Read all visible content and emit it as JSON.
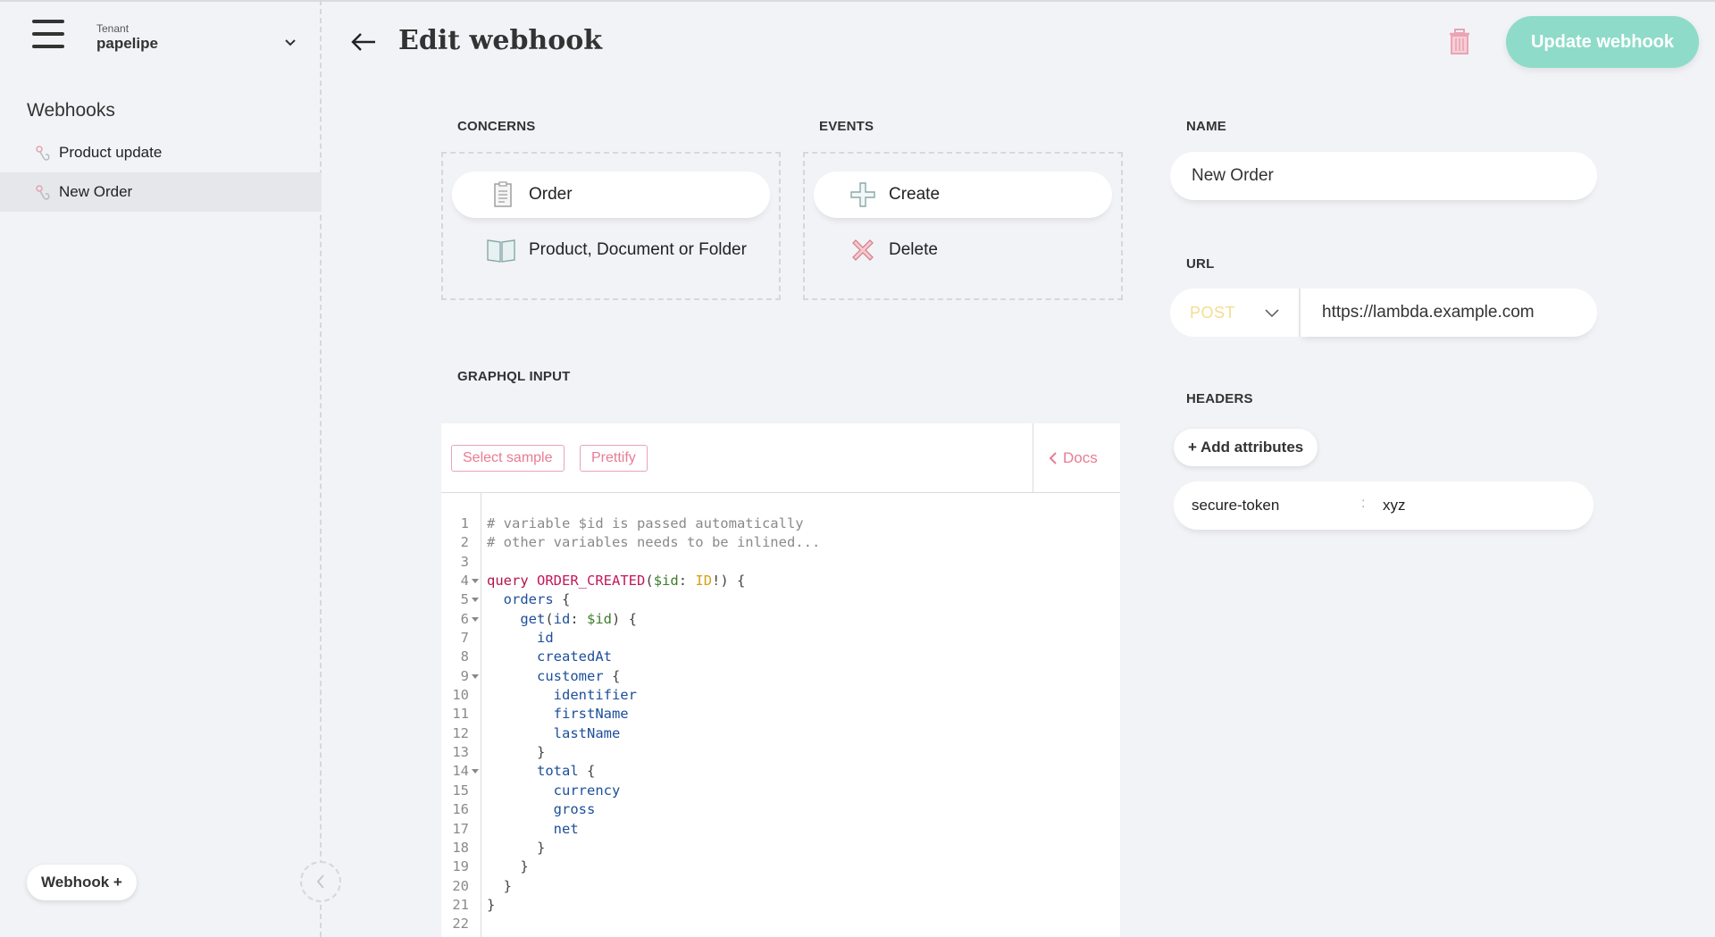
{
  "sidebar": {
    "tenant_label": "Tenant",
    "tenant_name": "papelipe",
    "section_title": "Webhooks",
    "items": [
      {
        "label": "Product update",
        "active": false
      },
      {
        "label": "New Order",
        "active": true
      }
    ],
    "add_button": "Webhook +"
  },
  "header": {
    "title": "Edit webhook",
    "update_button": "Update webhook"
  },
  "concerns": {
    "label": "CONCERNS",
    "options": [
      {
        "label": "Order",
        "icon": "clipboard-icon",
        "selected": true
      },
      {
        "label": "Product, Document or Folder",
        "icon": "book-icon",
        "selected": false
      }
    ]
  },
  "events": {
    "label": "EVENTS",
    "options": [
      {
        "label": "Create",
        "icon": "plus-icon",
        "selected": true
      },
      {
        "label": "Delete",
        "icon": "x-icon",
        "selected": false
      }
    ]
  },
  "name": {
    "label": "NAME",
    "value": "New Order"
  },
  "url": {
    "label": "URL",
    "method": "POST",
    "value": "https://lambda.example.com"
  },
  "headers": {
    "label": "HEADERS",
    "add_button": "+ Add attributes",
    "items": [
      {
        "key": "secure-token",
        "separator": ":",
        "value": "xyz"
      }
    ]
  },
  "graphql": {
    "label": "GRAPHQL INPUT",
    "select_sample": "Select sample",
    "prettify": "Prettify",
    "docs": "Docs",
    "lines": [
      {
        "n": "1",
        "fold": false,
        "tokens": [
          [
            "c-comment",
            "# variable $id is passed automatically"
          ]
        ]
      },
      {
        "n": "2",
        "fold": false,
        "tokens": [
          [
            "c-comment",
            "# other variables needs to be inlined..."
          ]
        ]
      },
      {
        "n": "3",
        "fold": false,
        "tokens": []
      },
      {
        "n": "4",
        "fold": true,
        "tokens": [
          [
            "c-kw",
            "query"
          ],
          [
            "c-punct",
            " "
          ],
          [
            "c-def",
            "ORDER_CREATED"
          ],
          [
            "c-punct",
            "("
          ],
          [
            "c-var",
            "$id"
          ],
          [
            "c-punct",
            ": "
          ],
          [
            "c-type",
            "ID"
          ],
          [
            "c-punct",
            "!) {"
          ]
        ]
      },
      {
        "n": "5",
        "fold": true,
        "tokens": [
          [
            "c-punct",
            "  "
          ],
          [
            "c-prop",
            "orders"
          ],
          [
            "c-punct",
            " {"
          ]
        ]
      },
      {
        "n": "6",
        "fold": true,
        "tokens": [
          [
            "c-punct",
            "    "
          ],
          [
            "c-prop",
            "get"
          ],
          [
            "c-punct",
            "("
          ],
          [
            "c-prop",
            "id"
          ],
          [
            "c-punct",
            ": "
          ],
          [
            "c-var",
            "$id"
          ],
          [
            "c-punct",
            ") {"
          ]
        ]
      },
      {
        "n": "7",
        "fold": false,
        "tokens": [
          [
            "c-punct",
            "      "
          ],
          [
            "c-prop",
            "id"
          ]
        ]
      },
      {
        "n": "8",
        "fold": false,
        "tokens": [
          [
            "c-punct",
            "      "
          ],
          [
            "c-prop",
            "createdAt"
          ]
        ]
      },
      {
        "n": "9",
        "fold": true,
        "tokens": [
          [
            "c-punct",
            "      "
          ],
          [
            "c-prop",
            "customer"
          ],
          [
            "c-punct",
            " {"
          ]
        ]
      },
      {
        "n": "10",
        "fold": false,
        "tokens": [
          [
            "c-punct",
            "        "
          ],
          [
            "c-prop",
            "identifier"
          ]
        ]
      },
      {
        "n": "11",
        "fold": false,
        "tokens": [
          [
            "c-punct",
            "        "
          ],
          [
            "c-prop",
            "firstName"
          ]
        ]
      },
      {
        "n": "12",
        "fold": false,
        "tokens": [
          [
            "c-punct",
            "        "
          ],
          [
            "c-prop",
            "lastName"
          ]
        ]
      },
      {
        "n": "13",
        "fold": false,
        "tokens": [
          [
            "c-punct",
            "      }"
          ]
        ]
      },
      {
        "n": "14",
        "fold": true,
        "tokens": [
          [
            "c-punct",
            "      "
          ],
          [
            "c-prop",
            "total"
          ],
          [
            "c-punct",
            " {"
          ]
        ]
      },
      {
        "n": "15",
        "fold": false,
        "tokens": [
          [
            "c-punct",
            "        "
          ],
          [
            "c-prop",
            "currency"
          ]
        ]
      },
      {
        "n": "16",
        "fold": false,
        "tokens": [
          [
            "c-punct",
            "        "
          ],
          [
            "c-prop",
            "gross"
          ]
        ]
      },
      {
        "n": "17",
        "fold": false,
        "tokens": [
          [
            "c-punct",
            "        "
          ],
          [
            "c-prop",
            "net"
          ]
        ]
      },
      {
        "n": "18",
        "fold": false,
        "tokens": [
          [
            "c-punct",
            "      }"
          ]
        ]
      },
      {
        "n": "19",
        "fold": false,
        "tokens": [
          [
            "c-punct",
            "    }"
          ]
        ]
      },
      {
        "n": "20",
        "fold": false,
        "tokens": [
          [
            "c-punct",
            "  }"
          ]
        ]
      },
      {
        "n": "21",
        "fold": false,
        "tokens": [
          [
            "c-punct",
            "}"
          ]
        ]
      },
      {
        "n": "22",
        "fold": false,
        "tokens": []
      }
    ]
  },
  "colors": {
    "accent_green": "#8edbc9",
    "accent_pink": "#e87c95",
    "method_yellow": "#f5dd8d",
    "background": "#f2f3f7"
  }
}
